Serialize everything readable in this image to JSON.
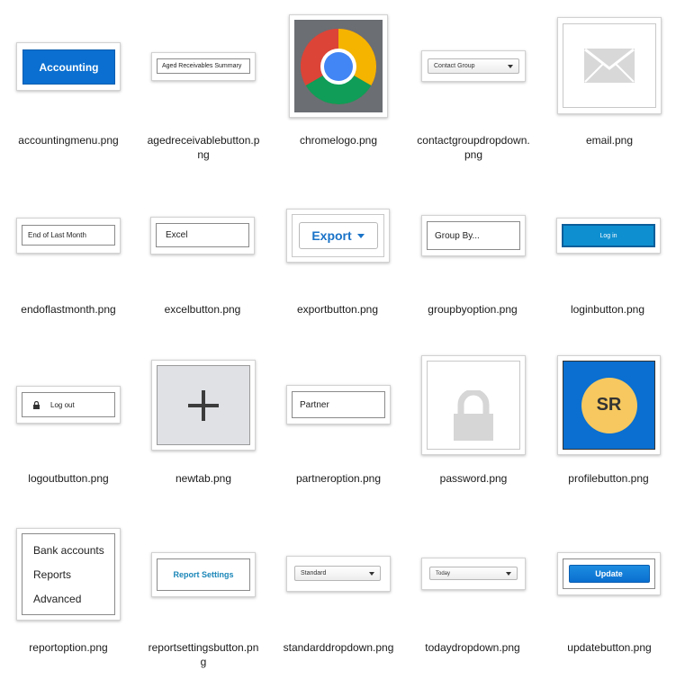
{
  "files": [
    {
      "name": "accountingmenu.png",
      "label": "Accounting"
    },
    {
      "name": "agedreceivablebutton.p\nng",
      "label": "Aged Receivables Summary"
    },
    {
      "name": "chromelogo.png"
    },
    {
      "name": "contactgroupdropdown.\npng",
      "label": "Contact Group"
    },
    {
      "name": "email.png"
    },
    {
      "name": "endoflastmonth.png",
      "label": "End of Last Month"
    },
    {
      "name": "excelbutton.png",
      "label": "Excel"
    },
    {
      "name": "exportbutton.png",
      "label": "Export"
    },
    {
      "name": "groupbyoption.png",
      "label": "Group By..."
    },
    {
      "name": "loginbutton.png",
      "label": "Log in"
    },
    {
      "name": "logoutbutton.png",
      "label": "Log out"
    },
    {
      "name": "newtab.png",
      "label": "+"
    },
    {
      "name": "partneroption.png",
      "label": "Partner"
    },
    {
      "name": "password.png"
    },
    {
      "name": "profilebutton.png",
      "label": "SR"
    },
    {
      "name": "reportoption.png",
      "options": [
        "Bank accounts",
        "Reports",
        "Advanced"
      ]
    },
    {
      "name": "reportsettingsbutton.pn\ng",
      "label": "Report Settings"
    },
    {
      "name": "standarddropdown.png",
      "label": "Standard"
    },
    {
      "name": "todaydropdown.png",
      "label": "Today"
    },
    {
      "name": "updatebutton.png",
      "label": "Update"
    }
  ],
  "colors": {
    "accent_blue": "#0a6fd0",
    "export_blue": "#1a73c8",
    "report_settings_teal": "#1a86b8",
    "profile_yellow": "#f6c85f"
  }
}
